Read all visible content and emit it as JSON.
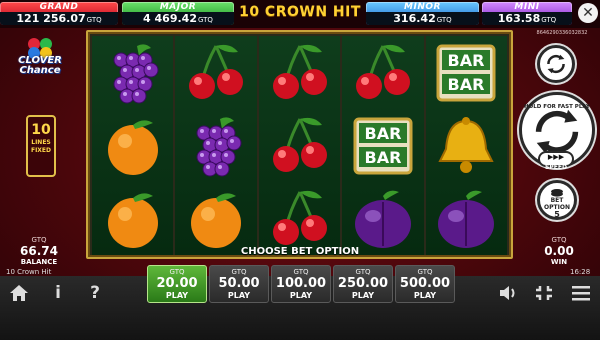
{
  "jackpots": [
    {
      "name": "GRAND",
      "amount": "121 256.07",
      "currency": "GTQ"
    },
    {
      "name": "MAJOR",
      "amount": "4 469.42",
      "currency": "GTQ"
    },
    {
      "name": "MINOR",
      "amount": "316.42",
      "currency": "GTQ"
    },
    {
      "name": "MINI",
      "amount": "163.58",
      "currency": "GTQ"
    }
  ],
  "game_title": "10 CROWN HIT",
  "logo": {
    "line1": "CLOVER",
    "line2": "Chance"
  },
  "lines": {
    "number": "10",
    "text1": "LINES",
    "text2": "FIXED"
  },
  "balance": {
    "currency": "GTQ",
    "amount": "66.74",
    "label": "BALANCE"
  },
  "win": {
    "currency": "GTQ",
    "amount": "0.00",
    "label": "WIN"
  },
  "reels": [
    [
      "grapes",
      "orange",
      "orange"
    ],
    [
      "cherries",
      "grapes",
      "orange"
    ],
    [
      "cherries",
      "cherries",
      "cherries"
    ],
    [
      "cherries",
      "bar",
      "plum"
    ],
    [
      "bar",
      "bell",
      "plum"
    ]
  ],
  "message": "CHOOSE BET OPTION",
  "session_id": "8646290336032832",
  "spin_label": "HOLD FOR FAST PLAY",
  "speed_label": "SPEED",
  "bet_option": {
    "label1": "BET",
    "label2": "OPTION",
    "value": "5"
  },
  "game_name": "10 Crown Hit",
  "clock": "16:28",
  "bet_options": [
    {
      "currency": "GTQ",
      "value": "20.00",
      "label": "PLAY",
      "active": true
    },
    {
      "currency": "GTQ",
      "value": "50.00",
      "label": "PLAY",
      "active": false
    },
    {
      "currency": "GTQ",
      "value": "100.00",
      "label": "PLAY",
      "active": false
    },
    {
      "currency": "GTQ",
      "value": "250.00",
      "label": "PLAY",
      "active": false
    },
    {
      "currency": "GTQ",
      "value": "500.00",
      "label": "PLAY",
      "active": false
    }
  ],
  "icons": {
    "home": "home-icon",
    "info": "info-icon",
    "help": "help-icon",
    "sound": "speaker-icon",
    "fullscreen": "fullscreen-icon",
    "menu": "hamburger-menu-icon"
  },
  "colors": {
    "grand": "#d01020",
    "major": "#2aa82a",
    "minor": "#2a82e0",
    "mini": "#9a3ad8",
    "title": "#ffd233",
    "active_bet": "#4aa02a"
  }
}
